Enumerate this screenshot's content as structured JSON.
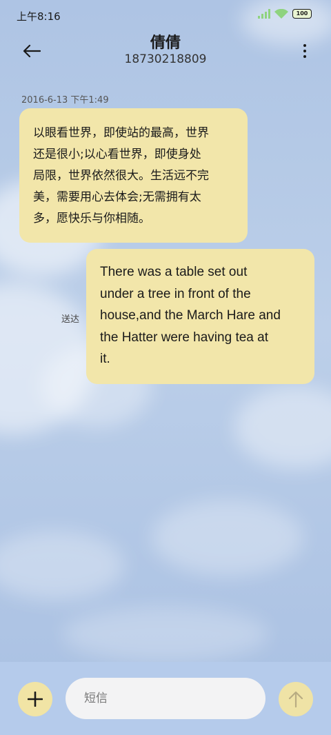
{
  "status_bar": {
    "time": "上午8:16",
    "battery": "100",
    "icons": [
      "signal-icon",
      "wifi-icon",
      "battery-icon"
    ]
  },
  "header": {
    "contact_name": "倩倩",
    "contact_number": "18730218809",
    "icons": [
      "back-arrow-icon",
      "more-vertical-icon"
    ]
  },
  "conversation": {
    "timestamp": "2016-6-13 下午1:49",
    "messages": [
      {
        "direction": "incoming",
        "text": "以眼看世界，即使站的最高，世界\n还是很小;以心看世界，即使身处\n局限，世界依然很大。生活远不完\n美，需要用心去体会;无需拥有太\n多，愿快乐与你相随。"
      },
      {
        "direction": "outgoing",
        "text": "There was a table set out\nunder a tree in front of the\nhouse,and the March Hare and\nthe Hatter were having tea at\nit.",
        "status": "送达"
      }
    ]
  },
  "composer": {
    "placeholder": "短信",
    "value": "",
    "icons": [
      "plus-icon",
      "send-arrow-up-icon"
    ]
  },
  "colors": {
    "bubble": "#f2e6aa",
    "background": "#b4c9e6",
    "composer_bar": "#b5cbeb",
    "input": "#f3f3f4"
  }
}
